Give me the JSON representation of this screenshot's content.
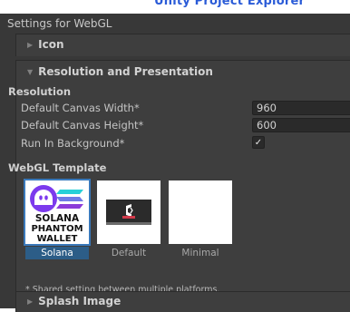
{
  "top_strip": {
    "text": "Unity Project Explorer"
  },
  "panel_title": "Settings for WebGL",
  "sections": {
    "icon": {
      "label": "Icon"
    },
    "resolution": {
      "label": "Resolution and Presentation",
      "sub_label": "Resolution",
      "rows": [
        {
          "label": "Default Canvas Width*",
          "value": "960"
        },
        {
          "label": "Default Canvas Height*",
          "value": "600"
        },
        {
          "label": "Run In Background*",
          "checked": true,
          "check_glyph": "✓"
        }
      ]
    },
    "webgl_template": {
      "label": "WebGL Template",
      "templates": [
        {
          "name": "Solana",
          "selected": true,
          "logo_lines": [
            "SOLANA",
            "PHANTOM",
            "WALLET"
          ]
        },
        {
          "name": "Default",
          "selected": false
        },
        {
          "name": "Minimal",
          "selected": false
        }
      ]
    },
    "shared_note": "* Shared setting between multiple platforms.",
    "splash": {
      "label": "Splash Image"
    }
  },
  "colors": {
    "panel_bg": "#383838",
    "foldout_bg": "#3e3e3e",
    "selected_blue": "#2c5d87",
    "logo_cyan": "#27d0d8",
    "logo_purple": "#8b3bd9",
    "phantom_purple": "#7c3aed"
  },
  "icons": [
    "foldout-arrow-icon",
    "checkmark-icon",
    "phantom-ghost-icon",
    "solana-stripes-icon",
    "unity-logo-icon"
  ]
}
